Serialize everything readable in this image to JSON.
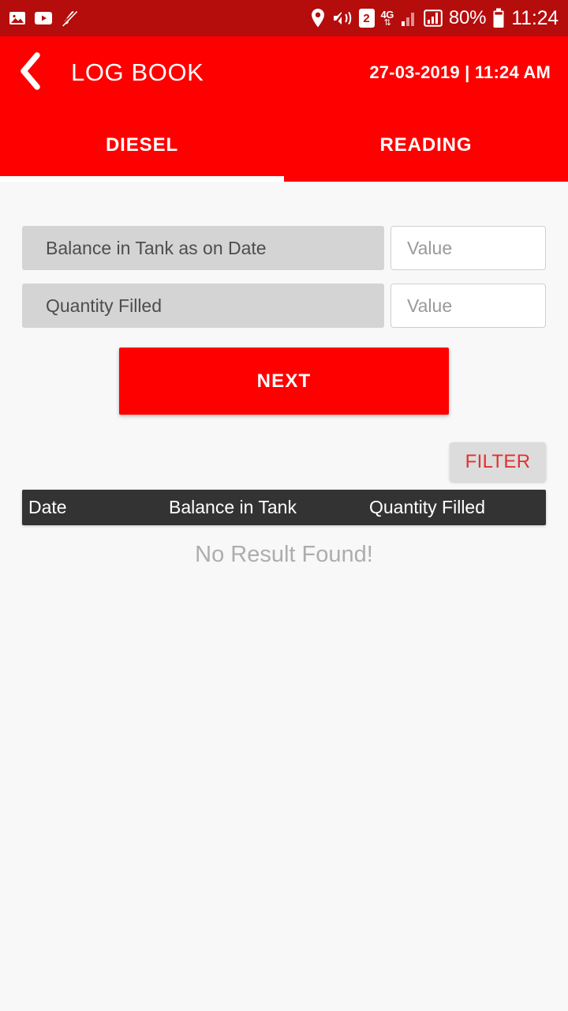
{
  "status_bar": {
    "left_icons": [
      {
        "name": "gallery-icon",
        "label": "image"
      },
      {
        "name": "youtube-icon",
        "label": "video"
      },
      {
        "name": "mute-brush-icon",
        "label": "muted"
      }
    ],
    "right_icons": [
      {
        "name": "location-pin-icon",
        "label": "location"
      },
      {
        "name": "vibrate-mute-icon",
        "label": "vibrate"
      }
    ],
    "sim_badge": "2",
    "network_type": "4G",
    "network_arrows": "↕",
    "battery_percent": "80%",
    "clock": "11:24"
  },
  "header": {
    "back_icon": "chevron-left-icon",
    "title": "LOG BOOK",
    "datetime": "27-03-2019 | 11:24 AM"
  },
  "tabs": [
    {
      "label": "DIESEL",
      "active": true
    },
    {
      "label": "READING",
      "active": false
    }
  ],
  "form": {
    "fields": [
      {
        "label": "Balance in Tank as on Date",
        "placeholder": "Value",
        "value": ""
      },
      {
        "label": "Quantity Filled",
        "placeholder": "Value",
        "value": ""
      }
    ],
    "next_label": "NEXT"
  },
  "filter": {
    "label": "FILTER"
  },
  "table": {
    "columns": [
      "Date",
      "Balance in Tank",
      "Quantity Filled"
    ],
    "rows": [],
    "empty_message": "No Result Found!"
  },
  "colors": {
    "status_bar": "#b50c0c",
    "brand_red": "#fe0000",
    "accent_red_text": "#e23131",
    "label_gray": "#d4d4d4",
    "table_header_dark": "#333333",
    "page_background": "#f8f8f8"
  }
}
